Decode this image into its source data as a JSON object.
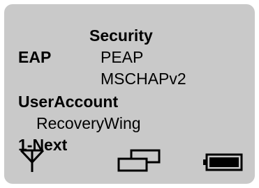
{
  "screen": {
    "title": "Security",
    "eap": {
      "label": "EAP",
      "method": "PEAP",
      "inner_method": "MSCHAPv2"
    },
    "user_account": {
      "label": "UserAccount",
      "value": "RecoveryWing"
    },
    "softkey": {
      "label": "1-Next"
    },
    "status_icons": [
      "antenna-signal-icon",
      "overlapping-windows-icon",
      "battery-full-icon"
    ]
  },
  "colors": {
    "screen_background": "#c9c9c9",
    "text": "#000000"
  }
}
